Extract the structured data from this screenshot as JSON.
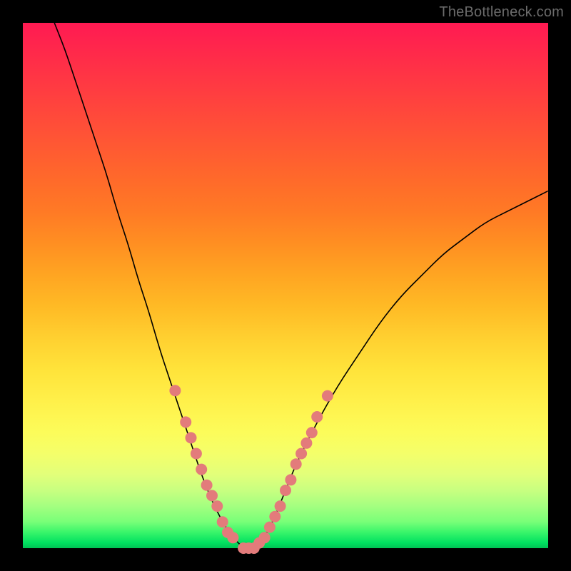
{
  "watermark": "TheBottleneck.com",
  "chart_data": {
    "type": "line",
    "title": "",
    "xlabel": "",
    "ylabel": "",
    "xlim": [
      0,
      100
    ],
    "ylim": [
      0,
      100
    ],
    "gradient_stops": [
      {
        "pos": 0,
        "color": "#ff1a52"
      },
      {
        "pos": 50,
        "color": "#ffa522"
      },
      {
        "pos": 78,
        "color": "#fcfc5a"
      },
      {
        "pos": 100,
        "color": "#00c254"
      }
    ],
    "series": [
      {
        "name": "bottleneck-curve",
        "x": [
          6,
          8,
          10,
          12,
          14,
          16,
          18,
          20,
          22,
          24,
          26,
          28,
          30,
          32,
          34,
          36,
          38,
          40,
          42,
          44,
          46,
          48,
          50,
          52,
          56,
          60,
          64,
          68,
          72,
          76,
          80,
          84,
          88,
          92,
          96,
          100
        ],
        "y": [
          100,
          95,
          89,
          83,
          77,
          71,
          64,
          58,
          51,
          45,
          38,
          32,
          26,
          20,
          14,
          9,
          5,
          2,
          0,
          0,
          2,
          6,
          11,
          16,
          24,
          31,
          37,
          43,
          48,
          52,
          56,
          59,
          62,
          64,
          66,
          68
        ]
      }
    ],
    "data_points": {
      "name": "highlighted-range",
      "color": "#e37b7b",
      "points": [
        {
          "x": 29,
          "y": 30
        },
        {
          "x": 31,
          "y": 24
        },
        {
          "x": 32,
          "y": 21
        },
        {
          "x": 33,
          "y": 18
        },
        {
          "x": 34,
          "y": 15
        },
        {
          "x": 35,
          "y": 12
        },
        {
          "x": 36,
          "y": 10
        },
        {
          "x": 37,
          "y": 8
        },
        {
          "x": 38,
          "y": 5
        },
        {
          "x": 39,
          "y": 3
        },
        {
          "x": 40,
          "y": 2
        },
        {
          "x": 42,
          "y": 0
        },
        {
          "x": 43,
          "y": 0
        },
        {
          "x": 44,
          "y": 0
        },
        {
          "x": 45,
          "y": 1
        },
        {
          "x": 46,
          "y": 2
        },
        {
          "x": 47,
          "y": 4
        },
        {
          "x": 48,
          "y": 6
        },
        {
          "x": 49,
          "y": 8
        },
        {
          "x": 50,
          "y": 11
        },
        {
          "x": 51,
          "y": 13
        },
        {
          "x": 52,
          "y": 16
        },
        {
          "x": 53,
          "y": 18
        },
        {
          "x": 54,
          "y": 20
        },
        {
          "x": 55,
          "y": 22
        },
        {
          "x": 56,
          "y": 25
        },
        {
          "x": 58,
          "y": 29
        }
      ]
    }
  }
}
